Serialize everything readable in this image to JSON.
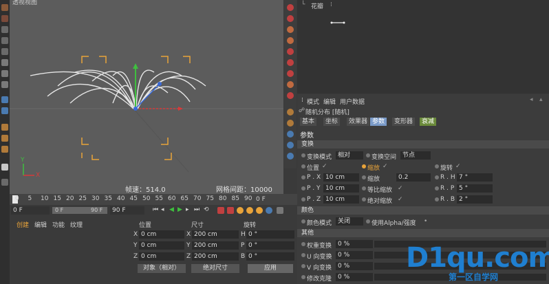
{
  "viewport": {
    "title": "透视视图",
    "fps_label": "帧速：514.0",
    "grid_label": "网格间距：10000 cm",
    "axis_y": "Y",
    "axis_x": "X"
  },
  "object_manager": {
    "object_name": "花瓣"
  },
  "attributes": {
    "menu": [
      "模式",
      "编辑",
      "用户数据"
    ],
    "object_title": "随机分布 [随机]",
    "tabs": [
      "基本",
      "坐标",
      "效果器",
      "参数",
      "变形器",
      "衰减"
    ],
    "active_tab": "参数",
    "header": "参数",
    "transform_section": "变换",
    "transform_mode_label": "变换模式",
    "transform_mode_value": "相对",
    "transform_space_label": "变换空间",
    "transform_space_value": "节点",
    "position_label": "位置",
    "scale_label": "缩放",
    "rotation_label": "旋转",
    "px_label": "P . X",
    "px_value": "10 cm",
    "py_label": "P . Y",
    "py_value": "10 cm",
    "pz_label": "P . Z",
    "pz_value": "10 cm",
    "scale_field_label": "缩放",
    "scale_value": "0.2",
    "uniform_scale_label": "等比缩放",
    "absolute_scale_label": "绝对缩放",
    "rh_label": "R . H",
    "rh_value": "7 °",
    "rp_label": "R . P",
    "rp_value": "5 °",
    "rb_label": "R . B",
    "rb_value": "2 °",
    "color_section": "颜色",
    "color_mode_label": "颜色模式",
    "color_mode_value": "关闭",
    "use_alpha_label": "使用Alpha/强度",
    "other_section": "其他",
    "weight_label": "权重变换",
    "weight_value": "0 %",
    "u_label": "U 向变换",
    "u_value": "0 %",
    "v_label": "V 向变换",
    "v_value": "0 %",
    "modify_label": "修改克隆",
    "modify_value": "0 %"
  },
  "timeline": {
    "ticks": [
      "0",
      "5",
      "10",
      "15",
      "20",
      "25",
      "30",
      "35",
      "40",
      "45",
      "50",
      "55",
      "60",
      "65",
      "70",
      "75",
      "80",
      "85",
      "90"
    ],
    "frame_end": "0 F",
    "start_frame": "0 F",
    "min_field": "0 F",
    "max_field": "90 F",
    "end_field": "90 F"
  },
  "coordinates": {
    "menu": [
      "创建",
      "编辑",
      "功能",
      "纹理"
    ],
    "col_position": "位置",
    "col_size": "尺寸",
    "col_rotation": "旋转",
    "x_label": "X",
    "x_value": "0 cm",
    "y_label": "Y",
    "y_value": "0 cm",
    "z_label": "Z",
    "z_value": "0 cm",
    "sx_label": "X",
    "sx_value": "200 cm",
    "sy_label": "Y",
    "sy_value": "200 cm",
    "sz_label": "Z",
    "sz_value": "200 cm",
    "h_label": "H",
    "h_value": "0 °",
    "p_label": "P",
    "p_value": "0 °",
    "b_label": "B",
    "b_value": "0 °",
    "mode_dropdown": "对象（相对）",
    "size_dropdown": "绝对尺寸",
    "apply_button": "应用"
  },
  "watermark": {
    "brand": "D1qu.com",
    "subtitle": "第一区自学网"
  },
  "colors": {
    "accent_orange": "#e8a33a",
    "axis_green": "#3fbf3f",
    "axis_red": "#d83a3a",
    "axis_blue": "#3a6ad8",
    "watermark_blue": "#1f7fd0"
  }
}
